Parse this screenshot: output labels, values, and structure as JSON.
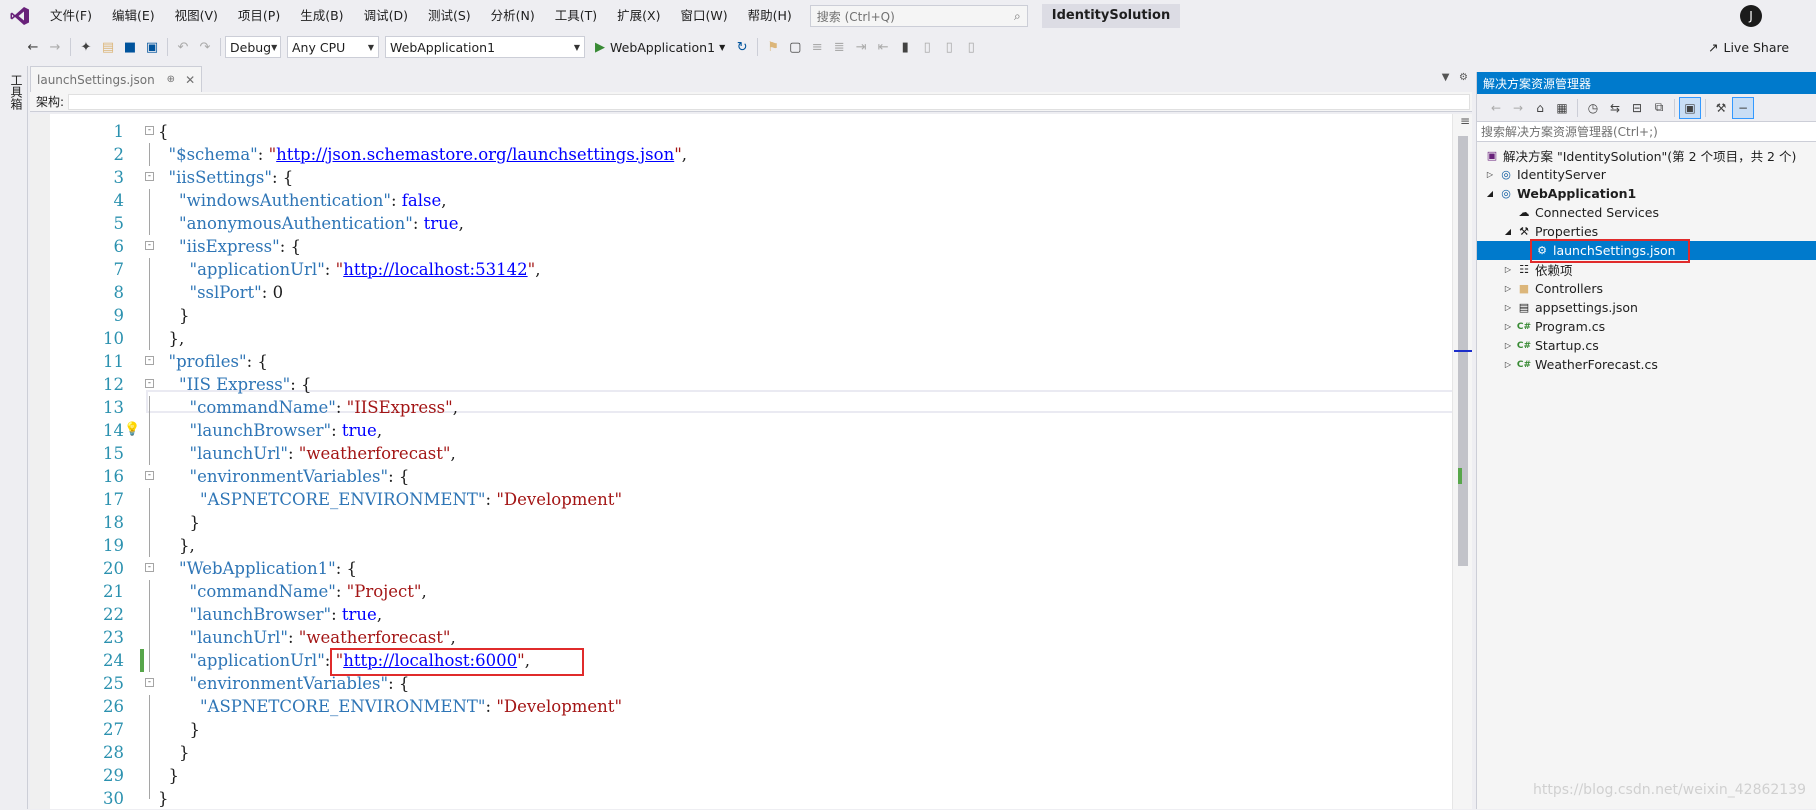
{
  "menu": {
    "items": [
      "文件(F)",
      "编辑(E)",
      "视图(V)",
      "项目(P)",
      "生成(B)",
      "调试(D)",
      "测试(S)",
      "分析(N)",
      "工具(T)",
      "扩展(X)",
      "窗口(W)",
      "帮助(H)"
    ],
    "search_placeholder": "搜索 (Ctrl+Q)",
    "solution_name": "IdentitySolution",
    "avatar_initial": "J"
  },
  "toolbar": {
    "config": "Debug",
    "platform": "Any CPU",
    "startup_project": "WebApplication1",
    "run_label": "WebApplication1",
    "live_share": "Live Share"
  },
  "toolbox": {
    "label": "工具箱"
  },
  "editor": {
    "tab_title": "launchSettings.json",
    "schema_label": "架构:",
    "lines": [
      {
        "n": "1"
      },
      {
        "n": "2"
      },
      {
        "n": "3"
      },
      {
        "n": "4"
      },
      {
        "n": "5"
      },
      {
        "n": "6"
      },
      {
        "n": "7"
      },
      {
        "n": "8"
      },
      {
        "n": "9"
      },
      {
        "n": "10"
      },
      {
        "n": "11"
      },
      {
        "n": "12"
      },
      {
        "n": "13"
      },
      {
        "n": "14"
      },
      {
        "n": "15"
      },
      {
        "n": "16"
      },
      {
        "n": "17"
      },
      {
        "n": "18"
      },
      {
        "n": "19"
      },
      {
        "n": "20"
      },
      {
        "n": "21"
      },
      {
        "n": "22"
      },
      {
        "n": "23"
      },
      {
        "n": "24"
      },
      {
        "n": "25"
      },
      {
        "n": "26"
      },
      {
        "n": "27"
      },
      {
        "n": "28"
      },
      {
        "n": "29"
      },
      {
        "n": "30"
      }
    ],
    "code": {
      "schema_key": "\"$schema\"",
      "schema_url": "http://json.schemastore.org/launchsettings.json",
      "iis_settings_key": "\"iisSettings\"",
      "windows_auth_key": "\"windowsAuthentication\"",
      "windows_auth_val": "false",
      "anon_auth_key": "\"anonymousAuthentication\"",
      "anon_auth_val": "true",
      "iis_express_key": "\"iisExpress\"",
      "app_url_key": "\"applicationUrl\"",
      "iis_app_url": "http://localhost:53142",
      "ssl_port_key": "\"sslPort\"",
      "ssl_port_val": "0",
      "profiles_key": "\"profiles\"",
      "iis_profile_key": "\"IIS Express\"",
      "command_name_key": "\"commandName\"",
      "iis_command_val": "\"IISExpress\"",
      "launch_browser_key": "\"launchBrowser\"",
      "launch_browser_val": "true",
      "launch_url_key": "\"launchUrl\"",
      "launch_url_val": "\"weatherforecast\"",
      "env_vars_key": "\"environmentVariables\"",
      "aspnet_env_key": "\"ASPNETCORE_ENVIRONMENT\"",
      "aspnet_env_val": "\"Development\"",
      "webapp_profile_key": "\"WebApplication1\"",
      "project_command_val": "\"Project\"",
      "webapp_app_url": "http://localhost:6000"
    }
  },
  "solution_explorer": {
    "title": "解决方案资源管理器",
    "search_placeholder": "搜索解决方案资源管理器(Ctrl+;)",
    "solution_line": "解决方案 \"IdentitySolution\"(第 2 个项目，共 2 个)",
    "items": [
      {
        "label": "IdentityServer"
      },
      {
        "label": "WebApplication1"
      },
      {
        "label": "Connected Services"
      },
      {
        "label": "Properties"
      },
      {
        "label": "launchSettings.json"
      },
      {
        "label": "依赖项"
      },
      {
        "label": "Controllers"
      },
      {
        "label": "appsettings.json"
      },
      {
        "label": "Program.cs"
      },
      {
        "label": "Startup.cs"
      },
      {
        "label": "WeatherForecast.cs"
      }
    ]
  },
  "watermark": "https://blog.csdn.net/weixin_42862139"
}
